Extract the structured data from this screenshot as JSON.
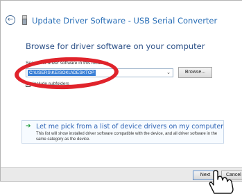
{
  "window": {
    "title": "Update Driver Software - USB Serial Converter",
    "back_icon": "back-arrow-icon",
    "device_icon": "usb-device-icon"
  },
  "main": {
    "heading": "Browse for driver software on your computer",
    "search_label": "Search for driver software in this location:",
    "path_value": "C:\\USERS\\KEISOKU\\DESKTOP",
    "browse_label": "Browse...",
    "include_subfolders_label": "Include subfolders",
    "include_subfolders_checked": true
  },
  "pick_option": {
    "title": "Let me pick from a list of device drivers on my computer",
    "description": "This list will show installed driver software compatible with the device, and all driver software in the same category as the device."
  },
  "footer": {
    "next_label": "Next",
    "cancel_label": "Cancel"
  },
  "colors": {
    "title_blue": "#2a6fb7",
    "heading_blue": "#2a4f86",
    "highlight_red": "#e0232b",
    "selection_blue": "#3b80d6"
  }
}
